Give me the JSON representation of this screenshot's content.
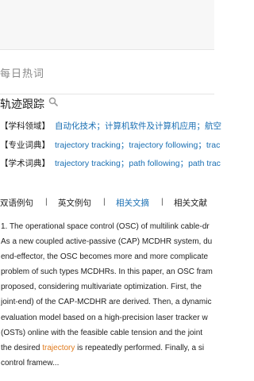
{
  "daily": {
    "label": "每日热词"
  },
  "entry": {
    "headword": "轨迹跟踪",
    "fields": [
      {
        "tag": "【学科领域】",
        "value": "自动化技术；计算机软件及计算机应用；航空"
      },
      {
        "tag": "【专业词典】",
        "value": "trajectory tracking；trajectory following；trac"
      },
      {
        "tag": "【学术词典】",
        "value": "trajectory tracking；path following；path trac"
      }
    ]
  },
  "tabs": {
    "items": [
      "双语例句",
      "英文例句",
      "相关文摘",
      "相关文献"
    ],
    "active_index": 2,
    "separator": "|"
  },
  "example": {
    "lines": [
      "1. The operational space control (OSC) of multilink cable-dr",
      "As a new coupled active-passive (CAP) MCDHR system, du",
      "end-effector, the OSC becomes more and more complicate",
      "problem of such types MCDHRs. In this paper, an OSC fram",
      "proposed, considering multivariate optimization. First, the",
      "joint-end) of the CAP-MCDHR are derived. Then, a dynamic",
      "evaluation model based on a high-precision laser tracker w",
      "(OSTs) online with the feasible cable tension and the joint",
      "control framew..."
    ],
    "hl_line_before": "the desired ",
    "hl_word": "trajectory",
    "hl_line_after": " is repeatedly performed. Finally, a si"
  },
  "colors": {
    "link": "#1a6fb3",
    "highlight": "#e07b1e"
  }
}
